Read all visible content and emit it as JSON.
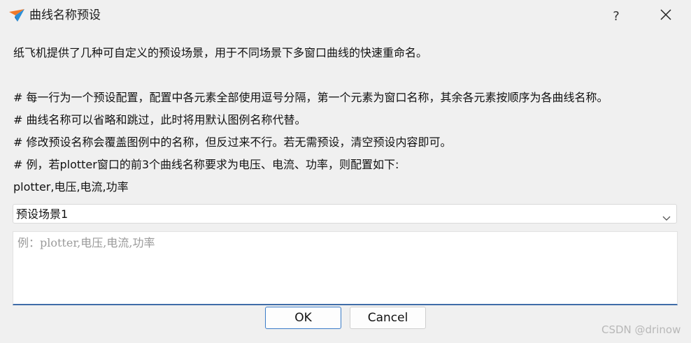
{
  "window": {
    "title": "曲线名称预设",
    "help_label": "?",
    "icon": "paper-plane-icon",
    "close_icon": "close-icon"
  },
  "description": {
    "lines": [
      "纸飞机提供了几种可自定义的预设场景，用于不同场景下多窗口曲线的快速重命名。",
      "",
      "# 每一行为一个预设配置，配置中各元素全部使用逗号分隔，第一个元素为窗口名称，其余各元素按顺序为各曲线名称。",
      "# 曲线名称可以省略和跳过，此时将用默认图例名称代替。",
      "# 修改预设名称会覆盖图例中的名称，但反过来不行。若无需预设，清空预设内容即可。",
      "# 例，若plotter窗口的前3个曲线名称要求为电压、电流、功率，则配置如下:",
      "plotter,电压,电流,功率"
    ]
  },
  "preset_select": {
    "value": "预设场景1"
  },
  "editor": {
    "value": "",
    "placeholder": "例：plotter,电压,电流,功率"
  },
  "buttons": {
    "ok": "OK",
    "cancel": "Cancel"
  },
  "watermark": "CSDN @drinow",
  "colors": {
    "accent": "#3a7bc8",
    "icon_orange": "#f07a2a",
    "icon_blue": "#2a8fd8"
  }
}
